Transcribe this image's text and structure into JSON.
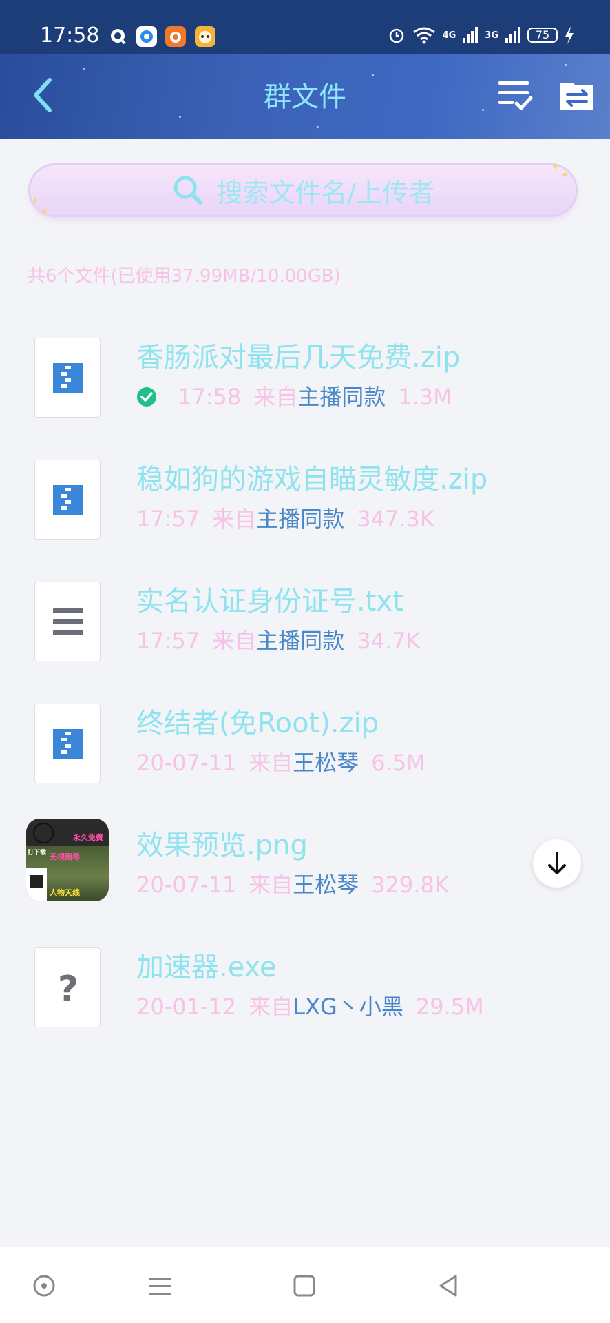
{
  "status_bar": {
    "time": "17:58",
    "network_1": "4G",
    "network_2": "3G",
    "battery": "75"
  },
  "header": {
    "title": "群文件"
  },
  "search": {
    "placeholder": "搜索文件名/上传者"
  },
  "summary": "共6个文件(已使用37.99MB/10.00GB)",
  "from_label": "来自",
  "files": [
    {
      "name": "香肠派对最后几天免费.zip",
      "time": "17:58",
      "uploader": "主播同款",
      "size": "1.3M",
      "type": "zip",
      "downloaded": true
    },
    {
      "name": "稳如狗的游戏自瞄灵敏度.zip",
      "time": "17:57",
      "uploader": "主播同款",
      "size": "347.3K",
      "type": "zip"
    },
    {
      "name": "实名认证身份证号.txt",
      "time": "17:57",
      "uploader": "主播同款",
      "size": "34.7K",
      "type": "txt"
    },
    {
      "name": "终结者(免Root).zip",
      "time": "20-07-11",
      "uploader": "王松琴",
      "size": "6.5M",
      "type": "zip"
    },
    {
      "name": "效果预览.png",
      "time": "20-07-11",
      "uploader": "王松琴",
      "size": "329.8K",
      "type": "image",
      "thumbnail_text": [
        "永久免费",
        "无视圈毒",
        "人物天线",
        "打下载"
      ]
    },
    {
      "name": "加速器.exe",
      "time": "20-01-12",
      "uploader": "LXG丶小黑",
      "size": "29.5M",
      "type": "unknown"
    }
  ],
  "colors": {
    "status_bar": "#1d3d78",
    "header_accent": "#8fe6ff",
    "file_name": "#8fe3ef",
    "meta_pink": "#f7c2e6",
    "uploader_blue": "#4a87c8",
    "zip_blue": "#3a86d8",
    "check_green": "#1fbf8a"
  },
  "icons": {
    "back": "chevron-left-icon",
    "multi_select": "checklist-icon",
    "transfer": "folder-transfer-icon",
    "search": "search-icon",
    "download": "arrow-down-icon",
    "nav": [
      "circle-dot-icon",
      "menu-icon",
      "square-icon",
      "triangle-back-icon"
    ]
  }
}
